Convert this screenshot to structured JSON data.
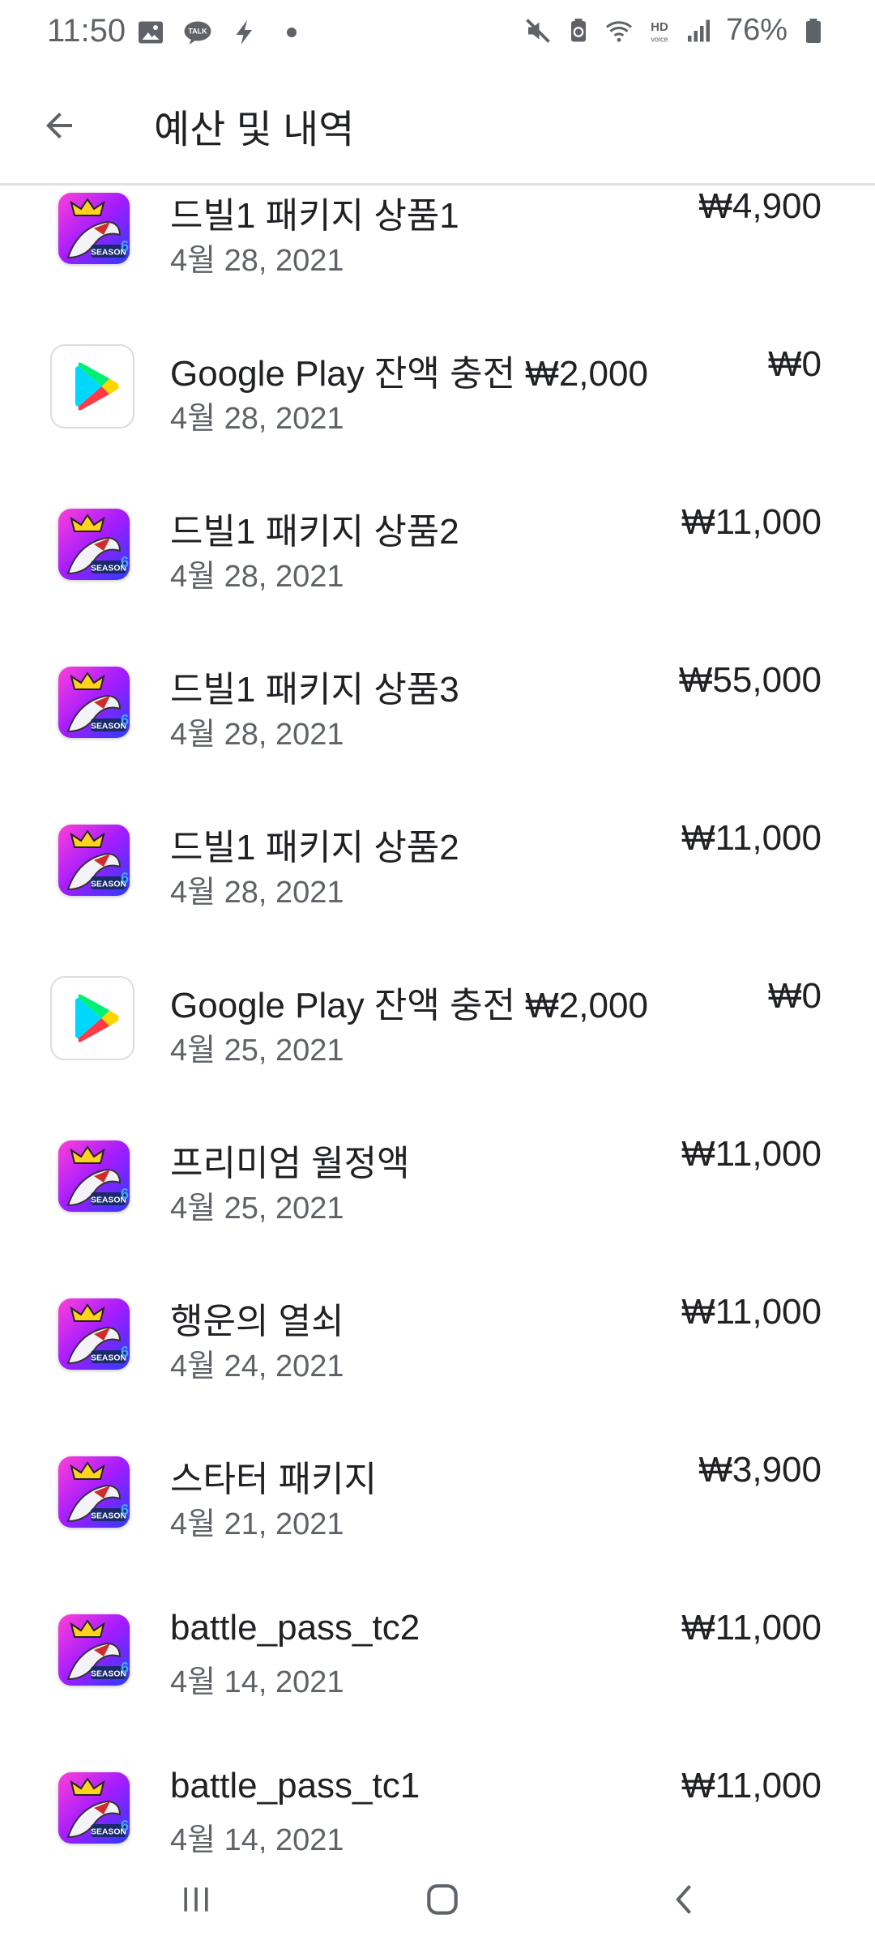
{
  "status_bar": {
    "time": "11:50",
    "battery": "76%",
    "left_icons": [
      "gallery-icon",
      "talk-icon",
      "bolt-icon",
      "dot-icon"
    ],
    "right_icons": [
      "mute-icon",
      "recycle-icon",
      "wifi-icon",
      "hd-voice-icon",
      "signal-icon",
      "battery-icon"
    ]
  },
  "header": {
    "title": "예산 및 내역"
  },
  "colors": {
    "text_primary": "#202124",
    "text_secondary": "#5f6368",
    "divider": "#e0e0e0"
  },
  "transactions": [
    {
      "title": "드빌1 패키지 상품1",
      "date": "4월 28, 2021",
      "amount": "₩4,900",
      "icon": "game-app-icon"
    },
    {
      "title": "Google Play 잔액 충전 ₩2,000",
      "date": "4월 28, 2021",
      "amount": "₩0",
      "icon": "google-play-icon"
    },
    {
      "title": "드빌1 패키지 상품2",
      "date": "4월 28, 2021",
      "amount": "₩11,000",
      "icon": "game-app-icon"
    },
    {
      "title": "드빌1 패키지 상품3",
      "date": "4월 28, 2021",
      "amount": "₩55,000",
      "icon": "game-app-icon"
    },
    {
      "title": "드빌1 패키지 상품2",
      "date": "4월 28, 2021",
      "amount": "₩11,000",
      "icon": "game-app-icon"
    },
    {
      "title": "Google Play 잔액 충전 ₩2,000",
      "date": "4월 25, 2021",
      "amount": "₩0",
      "icon": "google-play-icon"
    },
    {
      "title": "프리미엄 월정액",
      "date": "4월 25, 2021",
      "amount": "₩11,000",
      "icon": "game-app-icon"
    },
    {
      "title": "행운의 열쇠",
      "date": "4월 24, 2021",
      "amount": "₩11,000",
      "icon": "game-app-icon"
    },
    {
      "title": "스타터 패키지",
      "date": "4월 21, 2021",
      "amount": "₩3,900",
      "icon": "game-app-icon"
    },
    {
      "title": "battle_pass_tc2",
      "date": "4월 14, 2021",
      "amount": "₩11,000",
      "icon": "game-app-icon"
    },
    {
      "title": "battle_pass_tc1",
      "date": "4월 14, 2021",
      "amount": "₩11,000",
      "icon": "game-app-icon"
    }
  ],
  "nav_bar": {
    "buttons": [
      "recent-apps-icon",
      "home-icon",
      "back-icon"
    ]
  }
}
